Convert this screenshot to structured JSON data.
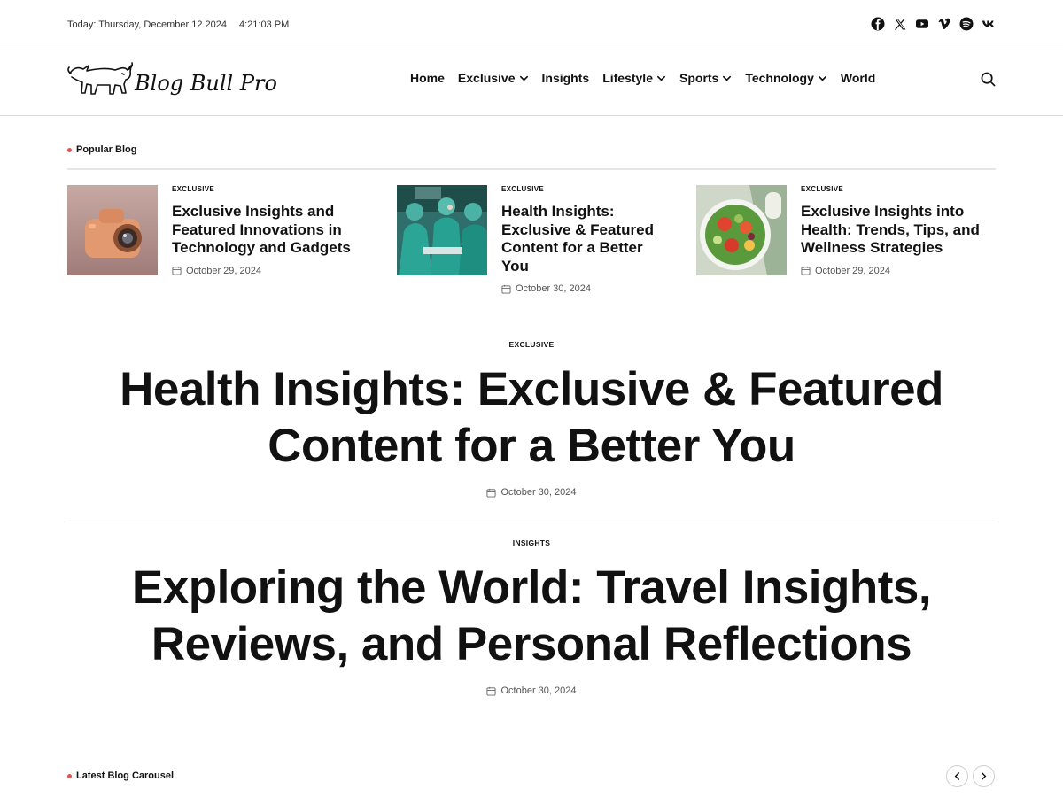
{
  "topbar": {
    "date": "Today: Thursday, December 12 2024",
    "time": "4:21:03 PM",
    "social": [
      "facebook-icon",
      "x-icon",
      "youtube-icon",
      "vimeo-icon",
      "spotify-icon",
      "vk-icon"
    ]
  },
  "header": {
    "logo_text": "Blog Bull Pro",
    "nav": [
      {
        "label": "Home",
        "dropdown": false
      },
      {
        "label": "Exclusive",
        "dropdown": true
      },
      {
        "label": "Insights",
        "dropdown": false
      },
      {
        "label": "Lifestyle",
        "dropdown": true
      },
      {
        "label": "Sports",
        "dropdown": true
      },
      {
        "label": "Technology",
        "dropdown": true
      },
      {
        "label": "World",
        "dropdown": false
      }
    ]
  },
  "popular": {
    "title": "Popular Blog",
    "items": [
      {
        "category": "EXCLUSIVE",
        "title": "Exclusive Insights and Featured Innovations in Technology and Gadgets",
        "date": "October 29, 2024"
      },
      {
        "category": "EXCLUSIVE",
        "title": "Health Insights: Exclusive & Featured Content for a Better You",
        "date": "October 30, 2024"
      },
      {
        "category": "EXCLUSIVE",
        "title": "Exclusive Insights into Health: Trends, Tips, and Wellness Strategies",
        "date": "October 29, 2024"
      }
    ]
  },
  "featured": [
    {
      "category": "EXCLUSIVE",
      "title": "Health Insights: Exclusive & Featured Content for a Better You",
      "date": "October 30, 2024"
    },
    {
      "category": "INSIGHTS",
      "title": "Exploring the World: Travel Insights, Reviews, and Personal Reflections",
      "date": "October 30, 2024"
    }
  ],
  "latest": {
    "title": "Latest Blog Carousel"
  },
  "colors": {
    "accent_dot": "#e05555",
    "text": "#111111",
    "muted": "#555555",
    "divider": "#e6e6e6"
  }
}
